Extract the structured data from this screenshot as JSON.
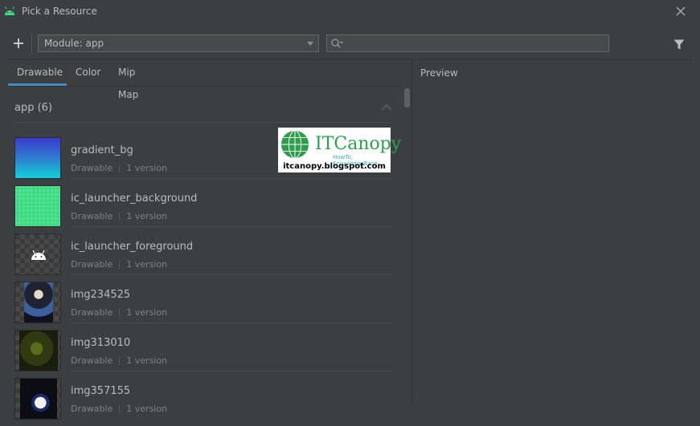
{
  "window": {
    "title": "Pick a Resource"
  },
  "toolbar": {
    "module_label": "Module: app",
    "search_value": ""
  },
  "tabs": [
    {
      "label": "Drawable",
      "active": true
    },
    {
      "label": "Color",
      "active": false
    },
    {
      "label": "Mip Map",
      "active": false
    }
  ],
  "preview": {
    "label": "Preview"
  },
  "group": {
    "label": "app (6)"
  },
  "resources": [
    {
      "name": "gradient_bg",
      "type": "Drawable",
      "versions": "1 version"
    },
    {
      "name": "ic_launcher_background",
      "type": "Drawable",
      "versions": "1 version"
    },
    {
      "name": "ic_launcher_foreground",
      "type": "Drawable",
      "versions": "1 version"
    },
    {
      "name": "img234525",
      "type": "Drawable",
      "versions": "1 version"
    },
    {
      "name": "img313010",
      "type": "Drawable",
      "versions": "1 version"
    },
    {
      "name": "img357155",
      "type": "Drawable",
      "versions": "1 version"
    }
  ],
  "watermark": {
    "brand": "ITCanopy",
    "tagline": "HowTo, KnowledgeBase",
    "url": "itcanopy.blogspot.com"
  },
  "colors": {
    "accent": "#4a88c7",
    "background": "#3c3f41",
    "android_green": "#3ddc84"
  }
}
